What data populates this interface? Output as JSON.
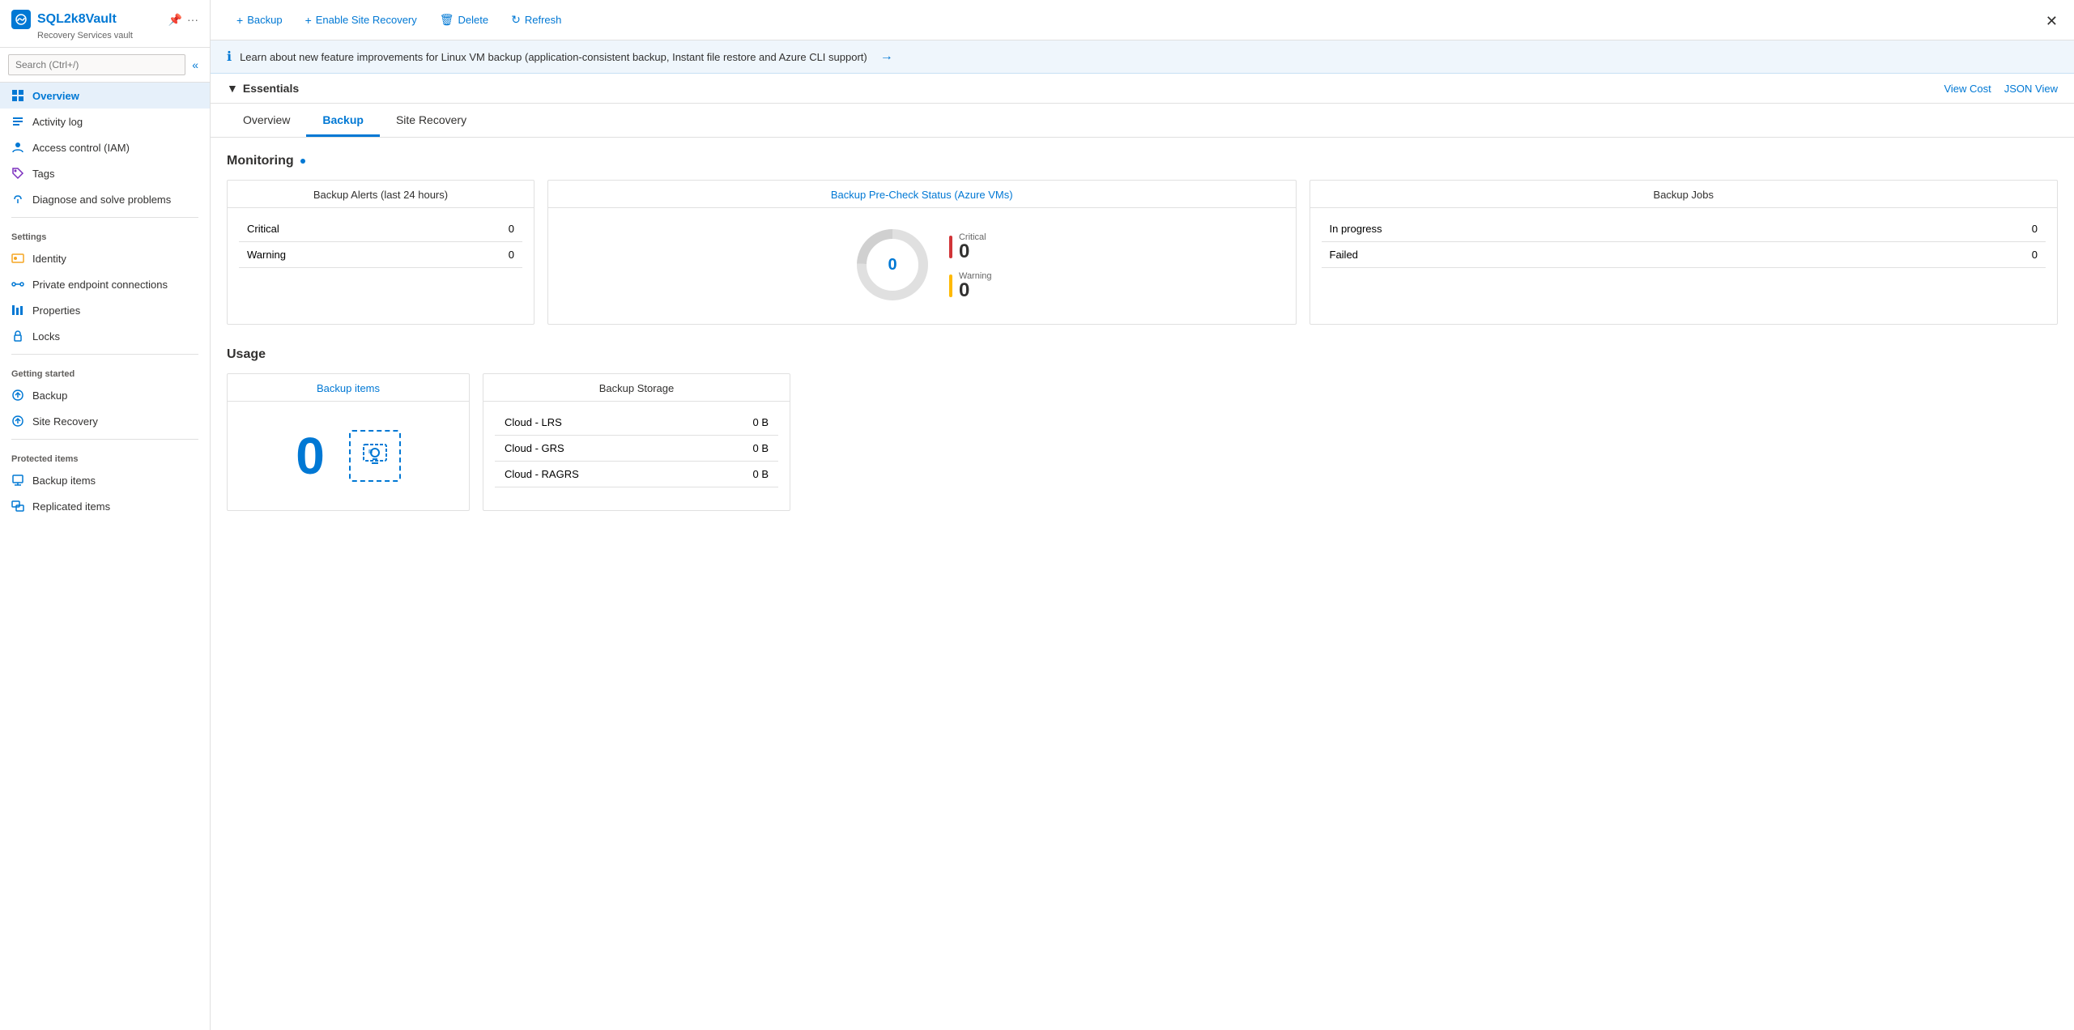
{
  "app": {
    "resource_name": "SQL2k8Vault",
    "resource_subtitle": "Recovery Services vault",
    "close_label": "✕"
  },
  "sidebar": {
    "search_placeholder": "Search (Ctrl+/)",
    "collapse_icon": "«",
    "items_main": [
      {
        "id": "overview",
        "label": "Overview",
        "icon": "⬡",
        "active": true
      },
      {
        "id": "activity-log",
        "label": "Activity log",
        "icon": "📋"
      },
      {
        "id": "access-control",
        "label": "Access control (IAM)",
        "icon": "👤"
      },
      {
        "id": "tags",
        "label": "Tags",
        "icon": "🏷"
      },
      {
        "id": "diagnose",
        "label": "Diagnose and solve problems",
        "icon": "🔧"
      }
    ],
    "section_settings": "Settings",
    "items_settings": [
      {
        "id": "identity",
        "label": "Identity",
        "icon": "🔑"
      },
      {
        "id": "private-endpoints",
        "label": "Private endpoint connections",
        "icon": "🔗"
      },
      {
        "id": "properties",
        "label": "Properties",
        "icon": "📊"
      },
      {
        "id": "locks",
        "label": "Locks",
        "icon": "🔒"
      }
    ],
    "section_getting_started": "Getting started",
    "items_getting_started": [
      {
        "id": "backup-gs",
        "label": "Backup",
        "icon": "☁"
      },
      {
        "id": "site-recovery-gs",
        "label": "Site Recovery",
        "icon": "☁"
      }
    ],
    "section_protected_items": "Protected items",
    "items_protected": [
      {
        "id": "backup-items",
        "label": "Backup items",
        "icon": "🖥"
      },
      {
        "id": "replicated-items",
        "label": "Replicated items",
        "icon": "🖥"
      }
    ]
  },
  "toolbar": {
    "backup_label": "Backup",
    "enable_site_recovery_label": "Enable Site Recovery",
    "delete_label": "Delete",
    "refresh_label": "Refresh"
  },
  "banner": {
    "text": "Learn about new feature improvements for Linux VM backup (application-consistent backup, Instant file restore and Azure CLI support)"
  },
  "essentials": {
    "label": "Essentials",
    "view_cost": "View Cost",
    "json_view": "JSON View"
  },
  "tabs": [
    {
      "id": "tab-overview",
      "label": "Overview"
    },
    {
      "id": "tab-backup",
      "label": "Backup",
      "active": true
    },
    {
      "id": "tab-site-recovery",
      "label": "Site Recovery"
    }
  ],
  "monitoring": {
    "title": "Monitoring",
    "alerts_card": {
      "title": "Backup Alerts (last 24 hours)",
      "rows": [
        {
          "label": "Critical",
          "value": "0"
        },
        {
          "label": "Warning",
          "value": "0"
        }
      ]
    },
    "precheck_card": {
      "title": "Backup Pre-Check Status (Azure VMs)",
      "center_value": "0",
      "legend": [
        {
          "type": "critical",
          "label": "Critical",
          "value": "0"
        },
        {
          "type": "warning",
          "label": "Warning",
          "value": "0"
        }
      ]
    },
    "jobs_card": {
      "title": "Backup Jobs",
      "rows": [
        {
          "label": "In progress",
          "value": "0"
        },
        {
          "label": "Failed",
          "value": "0"
        }
      ]
    }
  },
  "usage": {
    "title": "Usage",
    "backup_items_card": {
      "title": "Backup items",
      "count": "0"
    },
    "storage_card": {
      "title": "Backup Storage",
      "rows": [
        {
          "label": "Cloud - LRS",
          "value": "0 B"
        },
        {
          "label": "Cloud - GRS",
          "value": "0 B"
        },
        {
          "label": "Cloud - RAGRS",
          "value": "0 B"
        }
      ]
    }
  }
}
